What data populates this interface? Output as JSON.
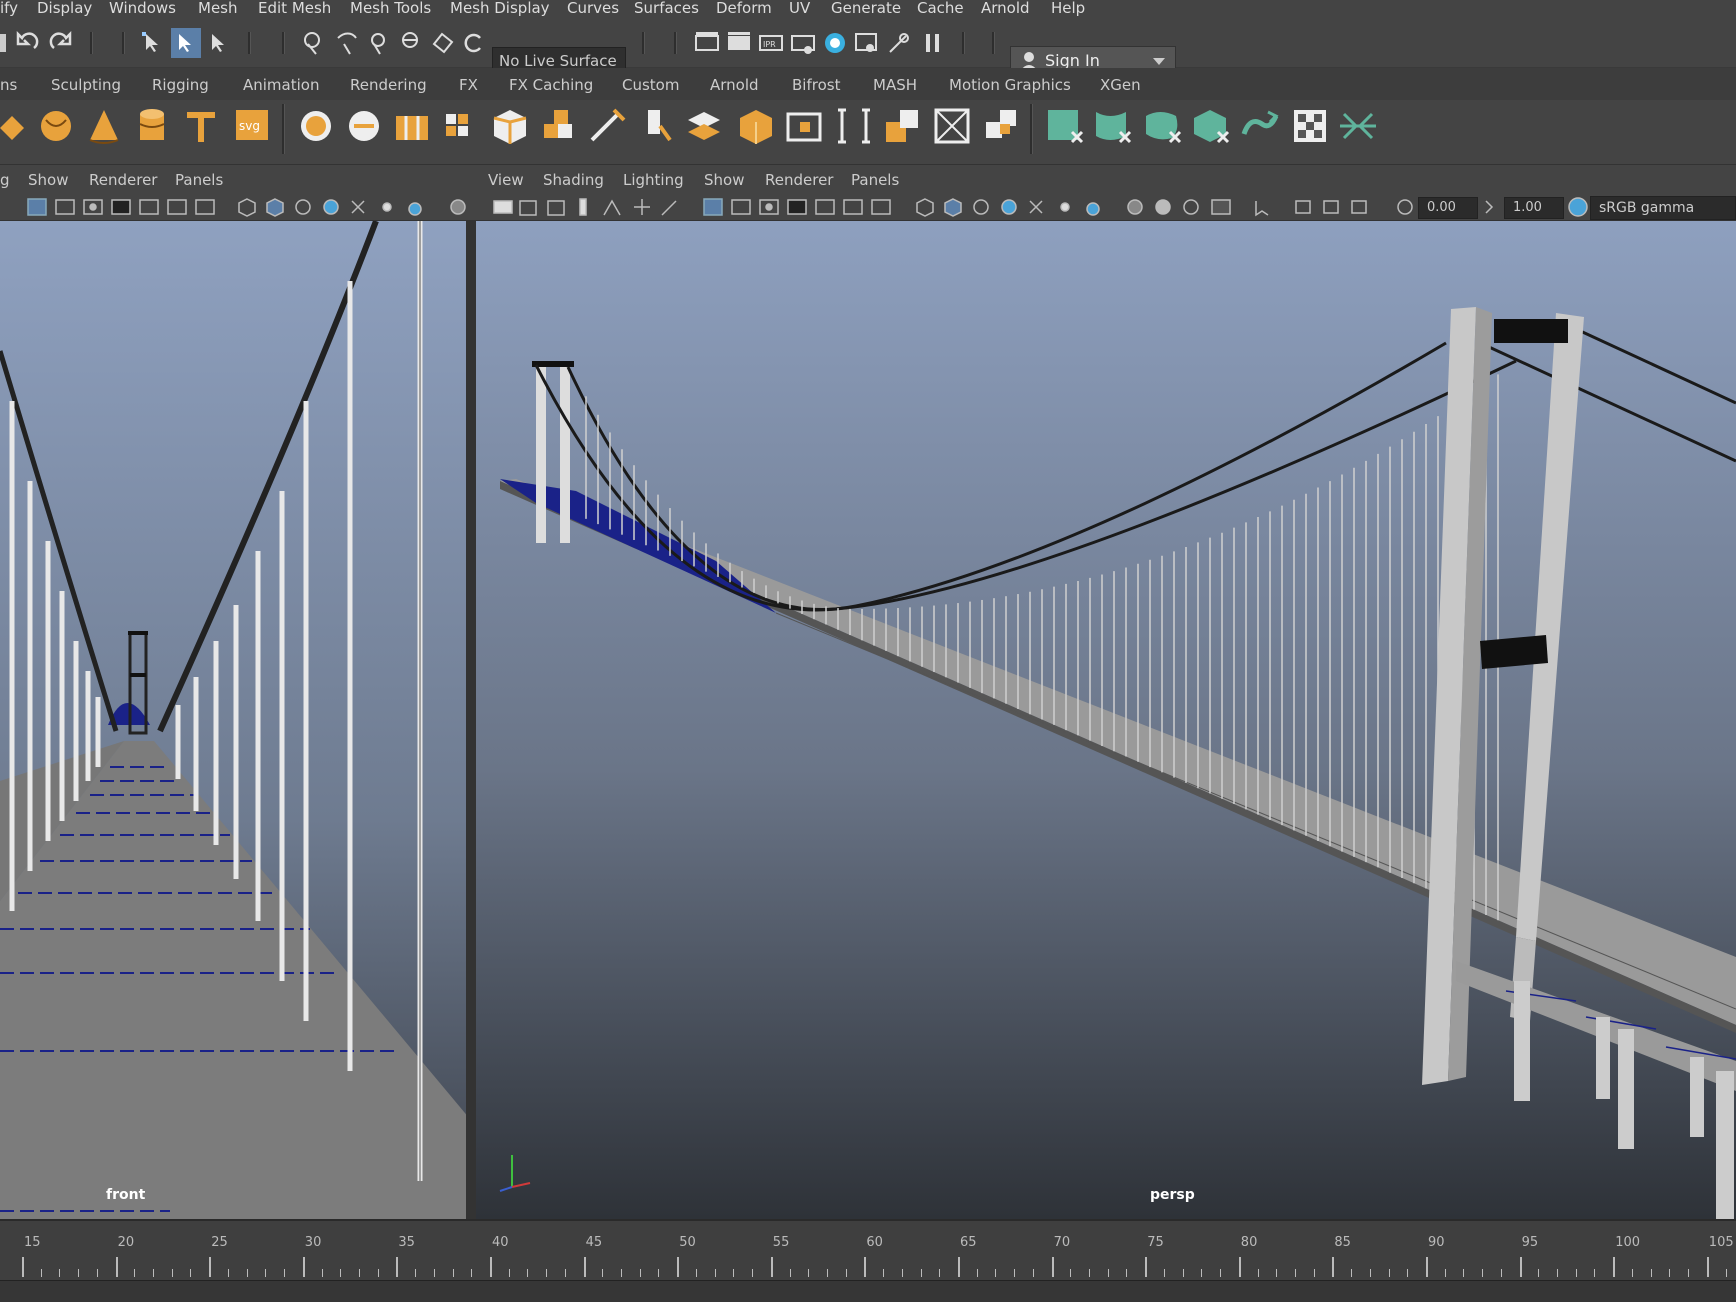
{
  "menus": [
    "ify",
    "Display",
    "Windows",
    "Mesh",
    "Edit Mesh",
    "Mesh Tools",
    "Mesh Display",
    "Curves",
    "Surfaces",
    "Deform",
    "UV",
    "Generate",
    "Cache",
    "Arnold",
    "Help"
  ],
  "status_line": {
    "live_surface": "No Live Surface",
    "sign_in": "Sign In"
  },
  "shelf_tabs": [
    "ns",
    "Sculpting",
    "Rigging",
    "Animation",
    "Rendering",
    "FX",
    "FX Caching",
    "Custom",
    "Arnold",
    "Bifrost",
    "MASH",
    "Motion Graphics",
    "XGen"
  ],
  "panel_left_menus": [
    "g",
    "Show",
    "Renderer",
    "Panels"
  ],
  "panel_right_menus": [
    "View",
    "Shading",
    "Lighting",
    "Show",
    "Renderer",
    "Panels"
  ],
  "panel_toolbar": {
    "exposure": "0.00",
    "gamma": "1.00",
    "color_space": "sRGB gamma"
  },
  "viewports": {
    "left_label": "front",
    "right_label": "persp"
  },
  "timeline_ticks": [
    "15",
    "20",
    "25",
    "30",
    "35",
    "40",
    "45",
    "50",
    "55",
    "60",
    "65",
    "70",
    "75",
    "80",
    "85",
    "90",
    "95",
    "100",
    "105"
  ],
  "colors": {
    "ui_bg": "#444444",
    "accent_orange": "#e8a23c",
    "accent_teal": "#5fb49c",
    "viewport_top": "#8ea0bf",
    "viewport_bottom": "#2e3238",
    "deck_blue": "#1a2288"
  }
}
